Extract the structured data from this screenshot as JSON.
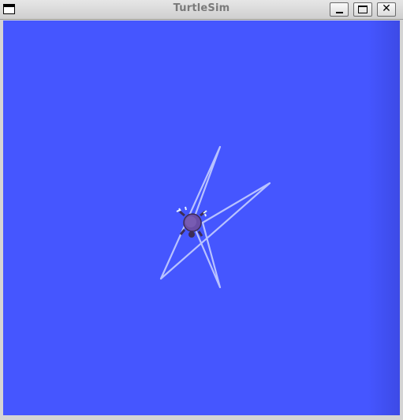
{
  "window": {
    "title": "TurtleSim",
    "menu_icon": "window-menu-icon",
    "controls": {
      "minimize_icon": "minimize-icon",
      "maximize_icon": "maximize-icon",
      "close_icon": "close-icon",
      "close_glyph": "✕"
    }
  },
  "canvas": {
    "background_color": "#4556ff",
    "pen_color": "#b8c2ff",
    "turtle_icon": "turtle-icon"
  }
}
